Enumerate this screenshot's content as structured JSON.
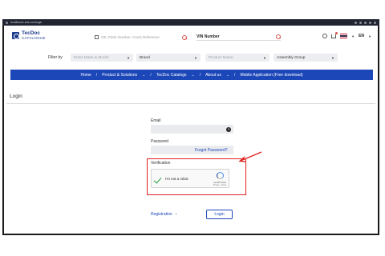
{
  "browser": {
    "url": "tecalliance-sea.com/login"
  },
  "header": {
    "logo_line1": "TecDoc",
    "logo_line2": "CATALOGUE",
    "search_placeholder": "OE, Parts Number, Cross Reference",
    "vin_label": "VIN Number",
    "language": "EN"
  },
  "filters": {
    "label": "Filter by",
    "dropdowns": [
      {
        "text": "Enter Make & Model",
        "is_placeholder": true
      },
      {
        "text": "Brand",
        "is_placeholder": false
      },
      {
        "text": "Product Name",
        "is_placeholder": true
      },
      {
        "text": "Assembly Group",
        "is_placeholder": false
      }
    ]
  },
  "nav": {
    "items": [
      {
        "label": "Home"
      },
      {
        "label": "Product & Solutions"
      },
      {
        "label": "TecDoc Catalogs"
      },
      {
        "label": "About us"
      },
      {
        "label": "Mobile Application (Free download)"
      }
    ]
  },
  "login": {
    "title": "Login",
    "email_label": "Email",
    "password_label": "Password",
    "forgot_password": "Forgot Password?",
    "verification_label": "Verification",
    "recaptcha_text": "I'm not a robot",
    "recaptcha_brand": "reCAPTCHA",
    "recaptcha_links": "Privacy - Terms",
    "registration_link": "Registration",
    "login_button": "Login"
  },
  "colors": {
    "brand_blue": "#1c47b8",
    "highlight_red": "#e02020",
    "check_green": "#1a9a3c"
  }
}
